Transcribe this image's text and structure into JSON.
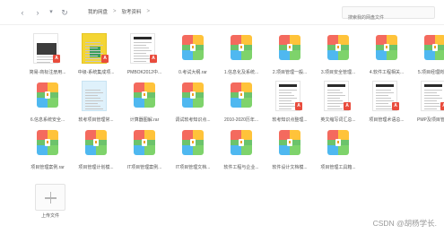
{
  "nav": {
    "back_icon": "‹",
    "forward_icon": "›",
    "dropdown_icon": "▾",
    "refresh_icon": "↻",
    "crumb_root": "我的网盘",
    "crumb_sep": ">",
    "crumb_current": "软考资料"
  },
  "search": {
    "placeholder": "搜索我的网盘文件"
  },
  "files": [
    {
      "name": "简易-商标注册用...",
      "kind": "pdf-photo"
    },
    {
      "name": "中级-系统集成项...",
      "kind": "pdf-yellow"
    },
    {
      "name": "PMBOK2012中...",
      "kind": "pdf-text"
    },
    {
      "name": "0.考试大纲.rar",
      "kind": "zip"
    },
    {
      "name": "1.信息化及系统...",
      "kind": "zip"
    },
    {
      "name": "2.项目管理一般...",
      "kind": "zip"
    },
    {
      "name": "3.项目安全管理...",
      "kind": "zip"
    },
    {
      "name": "4.软件工程相关...",
      "kind": "zip"
    },
    {
      "name": "5.项目经理岗位...",
      "kind": "zip"
    },
    {
      "name": "6.信息系统安全...",
      "kind": "zip"
    },
    {
      "name": "软考项目管理常...",
      "kind": "doc-blue"
    },
    {
      "name": "计算器图解.rar",
      "kind": "zip"
    },
    {
      "name": "调试软考知识点...",
      "kind": "zip"
    },
    {
      "name": "2010-2020历年...",
      "kind": "zip"
    },
    {
      "name": "软考知识点整理...",
      "kind": "pdf-text"
    },
    {
      "name": "英文缩写词汇总...",
      "kind": "pdf-text"
    },
    {
      "name": "项目管理术语总...",
      "kind": "pdf-text"
    },
    {
      "name": "PMP及项目管理...",
      "kind": "pdf-text"
    },
    {
      "name": "项目管理案例.rar",
      "kind": "zip"
    },
    {
      "name": "项目管理计划模...",
      "kind": "zip"
    },
    {
      "name": "IT项目管理案例...",
      "kind": "zip"
    },
    {
      "name": "IT项目管理文档...",
      "kind": "zip"
    },
    {
      "name": "软件工程与企业...",
      "kind": "zip"
    },
    {
      "name": "软件设计文档模...",
      "kind": "zip"
    },
    {
      "name": "项目管理工具箱...",
      "kind": "zip"
    }
  ],
  "upload": {
    "label": "上传文件",
    "icon": "plus-icon"
  },
  "watermark": "CSDN @胡杨学长."
}
